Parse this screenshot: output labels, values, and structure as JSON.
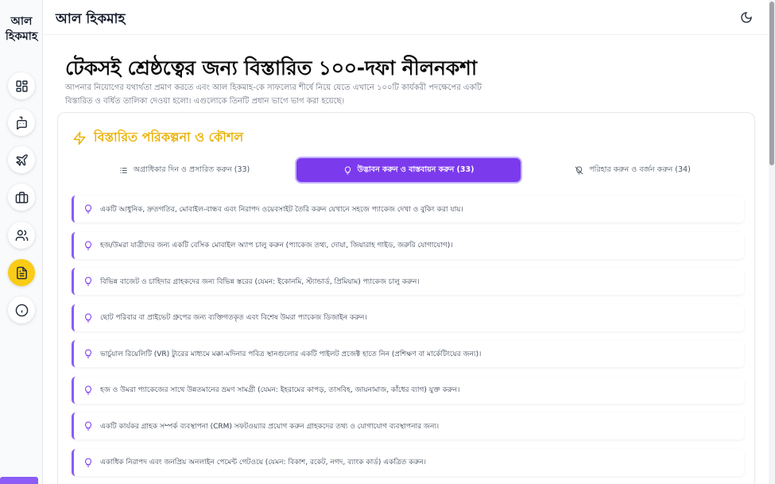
{
  "app": {
    "logo": "আল হিকমাহ",
    "header_title": "আল হিকমাহ"
  },
  "sidebar": {
    "items": [
      {
        "icon": "dashboard-icon",
        "active": false
      },
      {
        "icon": "chatbot-icon",
        "active": false
      },
      {
        "icon": "plane-icon",
        "active": false
      },
      {
        "icon": "briefcase-icon",
        "active": false
      },
      {
        "icon": "users-icon",
        "active": false
      },
      {
        "icon": "document-icon",
        "active": true
      },
      {
        "icon": "info-icon",
        "active": false
      }
    ]
  },
  "header": {
    "theme_icon": "moon-icon"
  },
  "main": {
    "title": "টেকসই শ্রেষ্ঠত্বের জন্য বিস্তারিত ১০০-দফা নীলনকশা",
    "description": "আপনার নিয়োগের যথার্থতা প্রমাণ করতে এবং আল হিকমাহ-কে সাফল্যের শীর্ষে নিয়ে যেতে এখানে ১০০টি কার্যকরী পদক্ষেপের একটি বিস্তারিত ও বর্ধিত তালিকা দেওয়া হলো। এগুলোকে তিনটি প্রধান ভাগে ভাগ করা হয়েছে।",
    "card_title": "বিস্তারিত পরিকল্পনা ও কৌশল",
    "tabs": [
      {
        "label": "অগ্রাধিকার দিন ও প্রসারিত করুন (33)",
        "icon": "list-icon",
        "active": false
      },
      {
        "label": "উদ্ভাবন করুন ও বাস্তবায়ন করুন (33)",
        "icon": "lightbulb-icon",
        "active": true
      },
      {
        "label": "পরিহার করুন ও বর্জন করুন (34)",
        "icon": "lightbulb-off-icon",
        "active": false
      }
    ],
    "items": [
      "একটি আধুনিক, দ্রুতগতির, মোবাইল-বান্ধব এবং নিরাপদ ওয়েবসাইট তৈরি করুন যেখানে সহজে প্যাকেজ দেখা ও বুকিং করা যায়।",
      "হজ/উমরা যাত্রীদের জন্য একটি বেসিক মোবাইল অ্যাপ চালু করুন (প্যাকেজ তথ্য, দোয়া, জিয়ারাহ গাইড, জরুরি যোগাযোগ)।",
      "বিভিন্ন বাজেট ও চাহিদার গ্রাহকদের জন্য বিভিন্ন স্তরের (যেমন: ইকোনমি, স্ট্যান্ডার্ড, প্রিমিয়াম) প্যাকেজ চালু করুন।",
      "ছোট পরিবার বা প্রাইভেট গ্রুপের জন্য ব্যক্তিগতকৃত এবং বিশেষ উমরা প্যাকেজ ডিজাইন করুন।",
      "ভার্চুয়াল রিয়েলিটি (VR) ট্যুরের মাধ্যমে মক্কা-মদিনার পবিত্র স্থানগুলোর একটি পাইলট প্রজেক্ট হাতে নিন (প্রশিক্ষণ বা মার্কেটিংয়ের জন্য)।",
      "হজ ও উমরা প্যাকেজের সাথে উন্নতমানের ভ্রমণ সামগ্রী (যেমন: ইহরামের কাপড়, তাসবিহ, জায়নামাজ, কাঁধের ব্যাগ) যুক্ত করুন।",
      "একটি কার্যকর গ্রাহক সম্পর্ক ব্যবস্থাপনা (CRM) সফটওয়্যার প্রয়োগ করুন গ্রাহকদের তথ্য ও যোগাযোগ ব্যবস্থাপনার জন্য।",
      "একাধিক নিরাপদ এবং জনপ্রিয় অনলাইন পেমেন্ট গেটওয়ে (যেমন: বিকাশ, রকেট, নগদ, ব্যাংক কার্ড) একত্রিত করুন।"
    ]
  },
  "colors": {
    "accent": "#7c3aed",
    "highlight": "#facc15",
    "card_title": "#eab308"
  }
}
